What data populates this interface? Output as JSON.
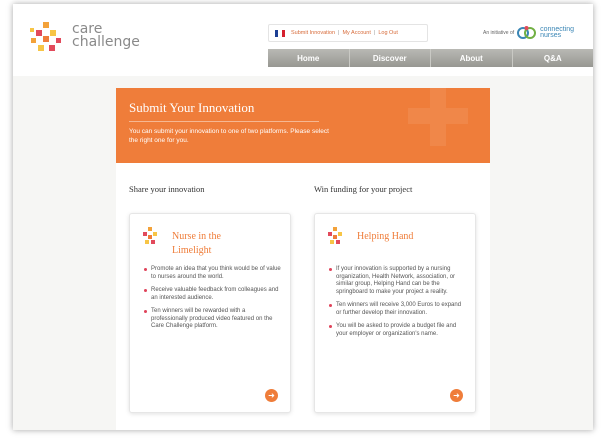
{
  "header": {
    "brand_line1": "care",
    "brand_line2": "challenge",
    "utility": {
      "submit": "Submit Innovation",
      "account": "My Account",
      "logout": "Log Out",
      "separator": "|"
    },
    "initiative_label": "An initiative of",
    "partner_line1": "connecting",
    "partner_line2": "nurses"
  },
  "nav": {
    "items": [
      "Home",
      "Discover",
      "About",
      "Q&A"
    ]
  },
  "banner": {
    "title": "Submit Your Innovation",
    "text": "You can submit your innovation to one of two platforms. Please select the right one for you."
  },
  "columns": [
    {
      "heading": "Share your innovation",
      "card_title_line1": "Nurse in the",
      "card_title_line2": "Limelight",
      "bullets": [
        "Promote an idea that you think would be of value to nurses around the world.",
        "Receive valuable feedback from colleagues and an interested audience.",
        "Ten winners will be rewarded with a professionally produced video featured on the Care Challenge platform."
      ],
      "button_icon": "arrow-right-icon"
    },
    {
      "heading": "Win funding for your project",
      "card_title_line1": "Helping Hand",
      "card_title_line2": "",
      "bullets": [
        "If your innovation is supported by a nursing organization, Health Network, association, or similar group, Helping Hand can be the springboard to make your project a reality.",
        "Ten winners will receive 3,000 Euros to expand or further develop their innovation.",
        "You will be asked to provide a budget file and your employer or organization's name."
      ],
      "button_icon": "arrow-right-icon"
    }
  ],
  "colors": {
    "accent": "#ef7d3a",
    "bullet": "#e0435a",
    "nav": "#a8a8a3"
  }
}
